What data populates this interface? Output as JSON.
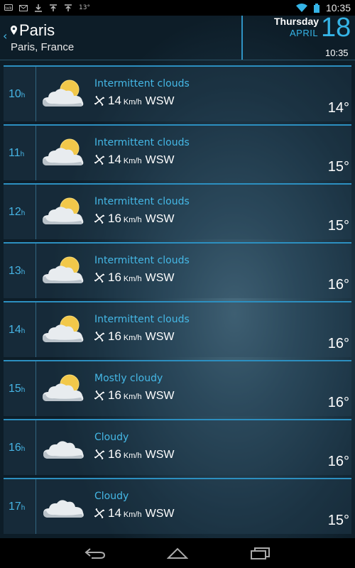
{
  "status_bar": {
    "left_icons": [
      "talk-icon",
      "mail-icon",
      "download-icon",
      "upload-icon",
      "upload-icon"
    ],
    "temp": "13°",
    "time": "10:35"
  },
  "header": {
    "city": "Paris",
    "subtitle": "Paris, France",
    "day_name": "Thursday",
    "month": "APRIL",
    "day_number": "18",
    "time": "10:35"
  },
  "rows": [
    {
      "hour": "10",
      "hour_suffix": "h",
      "icon": "partly-cloudy-icon",
      "condition": "Intermittent clouds",
      "wind_speed": "14",
      "wind_unit": "Km/h",
      "wind_dir": "WSW",
      "temp": "14°"
    },
    {
      "hour": "11",
      "hour_suffix": "h",
      "icon": "partly-cloudy-icon",
      "condition": "Intermittent clouds",
      "wind_speed": "14",
      "wind_unit": "Km/h",
      "wind_dir": "WSW",
      "temp": "15°"
    },
    {
      "hour": "12",
      "hour_suffix": "h",
      "icon": "partly-cloudy-icon",
      "condition": "Intermittent clouds",
      "wind_speed": "16",
      "wind_unit": "Km/h",
      "wind_dir": "WSW",
      "temp": "15°"
    },
    {
      "hour": "13",
      "hour_suffix": "h",
      "icon": "partly-cloudy-icon",
      "condition": "Intermittent clouds",
      "wind_speed": "16",
      "wind_unit": "Km/h",
      "wind_dir": "WSW",
      "temp": "16°"
    },
    {
      "hour": "14",
      "hour_suffix": "h",
      "icon": "partly-cloudy-icon",
      "condition": "Intermittent clouds",
      "wind_speed": "16",
      "wind_unit": "Km/h",
      "wind_dir": "WSW",
      "temp": "16°"
    },
    {
      "hour": "15",
      "hour_suffix": "h",
      "icon": "partly-cloudy-icon",
      "condition": "Mostly cloudy",
      "wind_speed": "16",
      "wind_unit": "Km/h",
      "wind_dir": "WSW",
      "temp": "16°"
    },
    {
      "hour": "16",
      "hour_suffix": "h",
      "icon": "cloud-icon",
      "condition": "Cloudy",
      "wind_speed": "16",
      "wind_unit": "Km/h",
      "wind_dir": "WSW",
      "temp": "16°"
    },
    {
      "hour": "17",
      "hour_suffix": "h",
      "icon": "cloud-icon",
      "condition": "Cloudy",
      "wind_speed": "14",
      "wind_unit": "Km/h",
      "wind_dir": "WSW",
      "temp": "15°"
    }
  ],
  "colors": {
    "accent": "#35b4e6",
    "row_border": "#2c8fc0"
  },
  "nav": {
    "buttons": [
      "back-icon",
      "home-icon",
      "recents-icon"
    ]
  }
}
